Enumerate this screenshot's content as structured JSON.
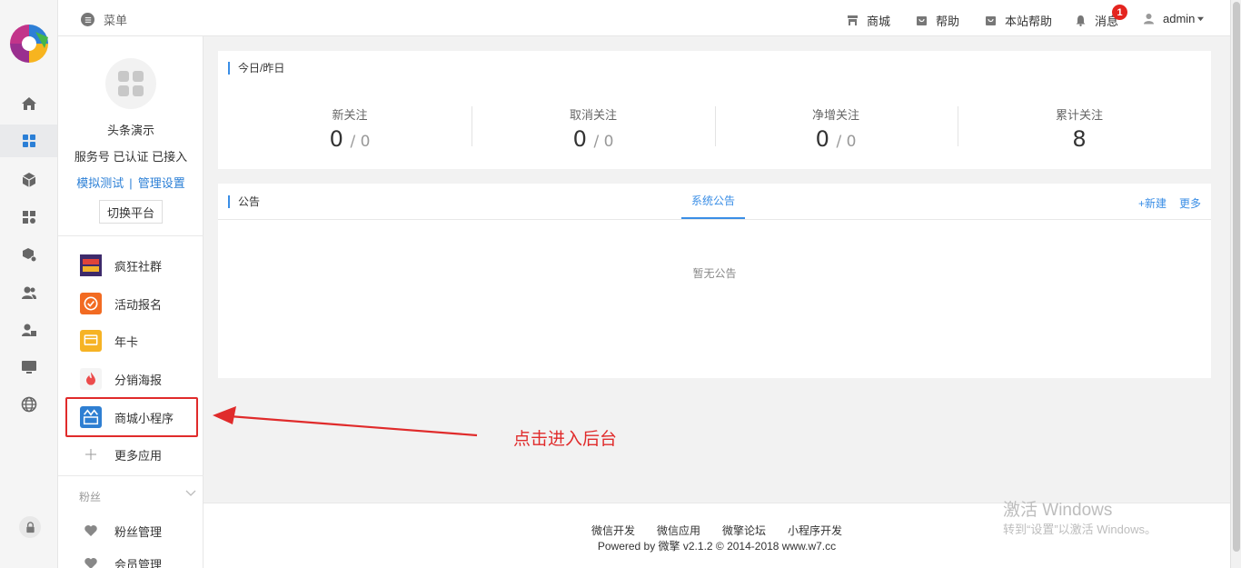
{
  "topbar": {
    "menu_label": "菜单",
    "items": [
      {
        "label": "商城",
        "icon": "store-icon"
      },
      {
        "label": "帮助",
        "icon": "help-bag-icon"
      },
      {
        "label": "本站帮助",
        "icon": "site-help-icon"
      },
      {
        "label": "消息",
        "icon": "bell-icon"
      }
    ],
    "message_count": "1",
    "user_label": "admin"
  },
  "account": {
    "name": "头条演示",
    "status": "服务号 已认证 已接入",
    "link_test": "模拟测试",
    "link_sep": "|",
    "link_manage": "管理设置",
    "switch_label": "切换平台"
  },
  "apps": [
    {
      "label": "疯狂社群",
      "icon": "crazy-community-icon",
      "color": "#3d2a6b"
    },
    {
      "label": "活动报名",
      "icon": "activity-signup-icon",
      "color": "#f26b22"
    },
    {
      "label": "年卡",
      "icon": "annual-card-icon",
      "color": "#f6b324"
    },
    {
      "label": "分销海报",
      "icon": "distribution-poster-icon",
      "color": "#f4f4f4"
    },
    {
      "label": "商城小程序",
      "icon": "mall-miniprogram-icon",
      "color": "#2f7fd2"
    },
    {
      "label": "更多应用",
      "icon": "plus-icon",
      "color": "#ffffff"
    }
  ],
  "fans_section": {
    "label": "粉丝",
    "items": [
      "粉丝管理",
      "会员管理"
    ]
  },
  "stats_panel": {
    "title": "今日/昨日",
    "stats": [
      {
        "label": "新关注",
        "today": "0",
        "yesterday": "/ 0"
      },
      {
        "label": "取消关注",
        "today": "0",
        "yesterday": "/ 0"
      },
      {
        "label": "净增关注",
        "today": "0",
        "yesterday": "/ 0"
      },
      {
        "label": "累计关注",
        "today": "8",
        "yesterday": ""
      }
    ]
  },
  "notice_panel": {
    "title": "公告",
    "tab_label": "系统公告",
    "new_label": "+新建",
    "more_label": "更多",
    "empty_text": "暂无公告"
  },
  "annotation": {
    "text": "点击进入后台",
    "color": "#e02b2b"
  },
  "footer": {
    "links": [
      "微信开发",
      "微信应用",
      "微擎论坛",
      "小程序开发"
    ],
    "powered": "Powered by 微擎 v2.1.2 © 2014-2018 www.w7.cc"
  },
  "watermark": {
    "title": "激活 Windows",
    "subtitle": "转到“设置”以激活 Windows。"
  },
  "colors": {
    "accent": "#3a8ee6",
    "badge": "#e4241f"
  }
}
